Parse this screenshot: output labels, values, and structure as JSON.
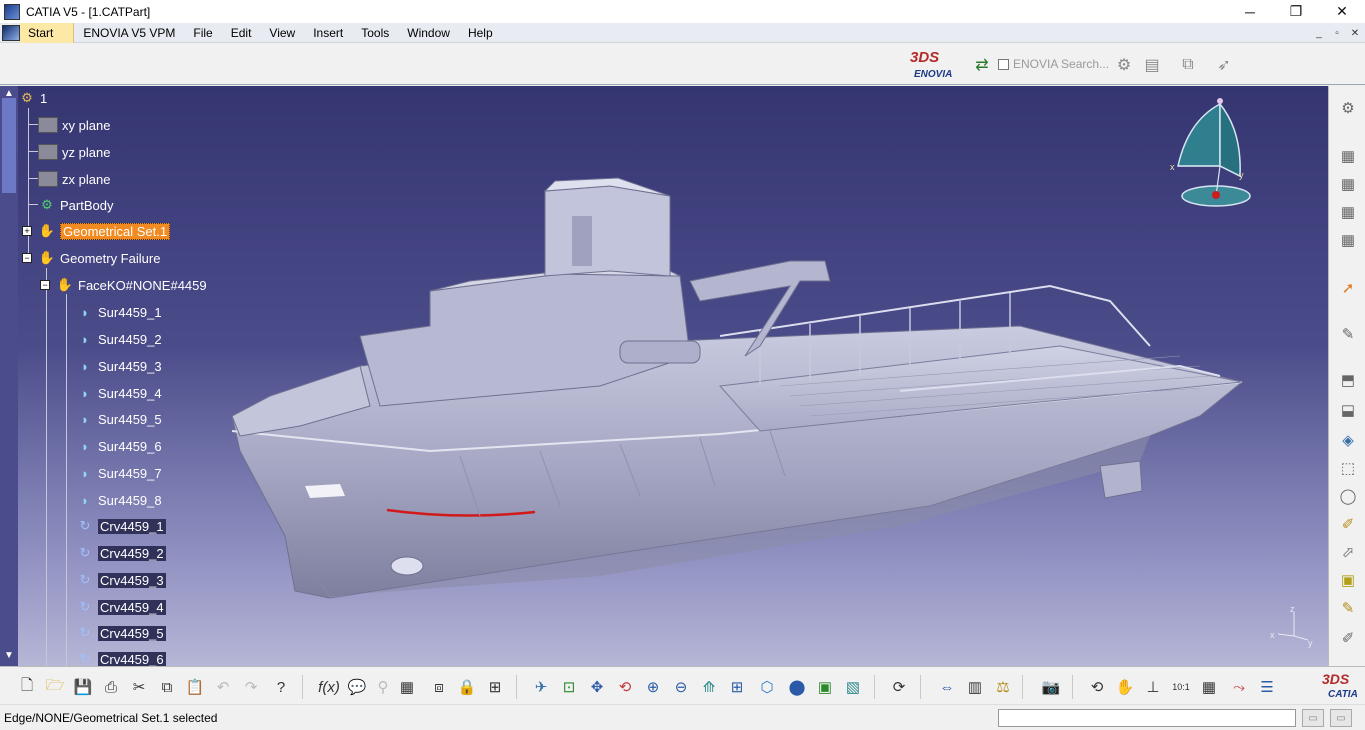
{
  "window": {
    "title": "CATIA V5 - [1.CATPart]",
    "minimize": "─",
    "restore": "❐",
    "close": "✕"
  },
  "menu": {
    "start": "Start",
    "items": [
      "ENOVIA V5 VPM",
      "File",
      "Edit",
      "View",
      "Insert",
      "Tools",
      "Window",
      "Help"
    ],
    "mdi_minimize": "_",
    "mdi_restore": "▫",
    "mdi_close": "✕"
  },
  "top_toolbar": {
    "enovia_logo_ds": "3DS",
    "enovia_logo_text": "ENOVIA",
    "enovia_search_label": "ENOVIA Search..."
  },
  "tree": {
    "root": "1",
    "planes": [
      "xy plane",
      "yz plane",
      "zx plane"
    ],
    "part_body": "PartBody",
    "geometrical_set": "Geometrical Set.1",
    "geometry_failure": "Geometry Failure",
    "face_ko": "FaceKO#NONE#4459",
    "surfaces": [
      "Sur4459_1",
      "Sur4459_2",
      "Sur4459_3",
      "Sur4459_4",
      "Sur4459_5",
      "Sur4459_6",
      "Sur4459_7",
      "Sur4459_8"
    ],
    "curves": [
      "Crv4459_1",
      "Crv4459_2",
      "Crv4459_3",
      "Crv4459_4",
      "Crv4459_5",
      "Crv4459_6"
    ]
  },
  "compass": {
    "x": "x",
    "y": "y"
  },
  "axis_triad": {
    "x": "x",
    "y": "y",
    "z": "z"
  },
  "bottom_toolbar": {
    "catia_logo_ds": "3DS",
    "catia_logo_text": "CATIA",
    "scale_label": "10:1"
  },
  "status": {
    "message": "Edge/NONE/Geometrical Set.1 selected",
    "command_value": ""
  },
  "colors": {
    "viewport_top": "#343571",
    "viewport_bottom": "#b6b6d6",
    "selection": "#f18a20",
    "menu_start": "#fde9a6"
  }
}
